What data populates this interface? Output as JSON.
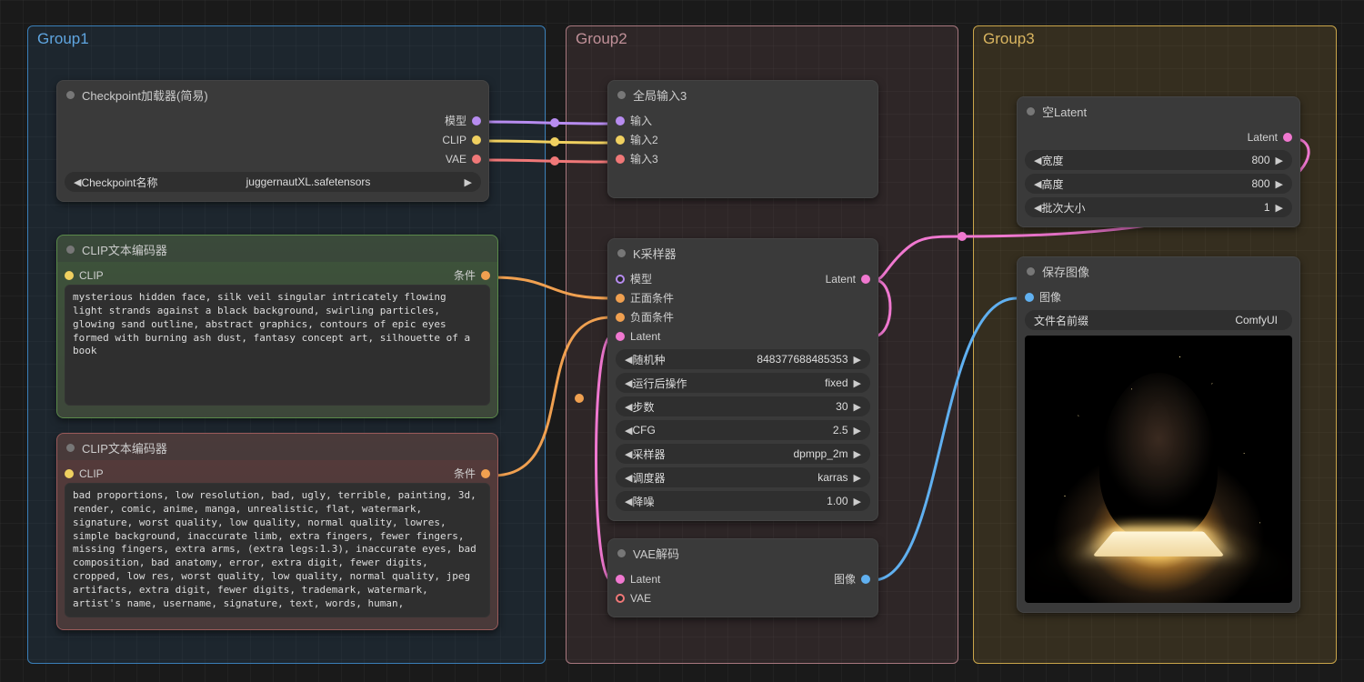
{
  "groups": {
    "g1": "Group1",
    "g2": "Group2",
    "g3": "Group3"
  },
  "checkpoint": {
    "title": "Checkpoint加载器(简易)",
    "outputs": {
      "model": "模型",
      "clip": "CLIP",
      "vae": "VAE"
    },
    "widget_label": "Checkpoint名称",
    "widget_value": "juggernautXL.safetensors"
  },
  "clip_pos": {
    "title": "CLIP文本编码器",
    "input": "CLIP",
    "output": "条件",
    "text": "mysterious hidden face, silk veil singular intricately flowing light strands against a black background, swirling particles, glowing sand outline, abstract graphics, contours of epic eyes formed with burning ash dust, fantasy concept art, silhouette of a book"
  },
  "clip_neg": {
    "title": "CLIP文本编码器",
    "input": "CLIP",
    "output": "条件",
    "text": "bad proportions, low resolution, bad, ugly, terrible, painting, 3d, render, comic, anime, manga, unrealistic, flat, watermark, signature, worst quality, low quality, normal quality, lowres, simple background, inaccurate limb, extra fingers, fewer fingers, missing fingers, extra arms, (extra legs:1.3), inaccurate eyes, bad composition, bad anatomy, error, extra digit, fewer digits, cropped, low res, worst quality, low quality, normal quality, jpeg artifacts, extra digit, fewer digits, trademark, watermark, artist's name, username, signature, text, words, human,"
  },
  "reroute": {
    "title": "全局输入3",
    "in1": "输入",
    "in2": "输入2",
    "in3": "输入3"
  },
  "ksampler": {
    "title": "K采样器",
    "inputs": {
      "model": "模型",
      "pos": "正面条件",
      "neg": "负面条件",
      "latent": "Latent"
    },
    "output": "Latent",
    "widgets": {
      "seed": {
        "label": "随机种",
        "value": "848377688485353"
      },
      "control": {
        "label": "运行后操作",
        "value": "fixed"
      },
      "steps": {
        "label": "步数",
        "value": "30"
      },
      "cfg": {
        "label": "CFG",
        "value": "2.5"
      },
      "sampler": {
        "label": "采样器",
        "value": "dpmpp_2m"
      },
      "scheduler": {
        "label": "调度器",
        "value": "karras"
      },
      "denoise": {
        "label": "降噪",
        "value": "1.00"
      }
    }
  },
  "empty_latent": {
    "title": "空Latent",
    "output": "Latent",
    "widgets": {
      "width": {
        "label": "宽度",
        "value": "800"
      },
      "height": {
        "label": "高度",
        "value": "800"
      },
      "batch": {
        "label": "批次大小",
        "value": "1"
      }
    }
  },
  "vae_decode": {
    "title": "VAE解码",
    "inputs": {
      "latent": "Latent",
      "vae": "VAE"
    },
    "output": "图像"
  },
  "save": {
    "title": "保存图像",
    "input": "图像",
    "widget_label": "文件名前缀",
    "widget_value": "ComfyUI"
  }
}
